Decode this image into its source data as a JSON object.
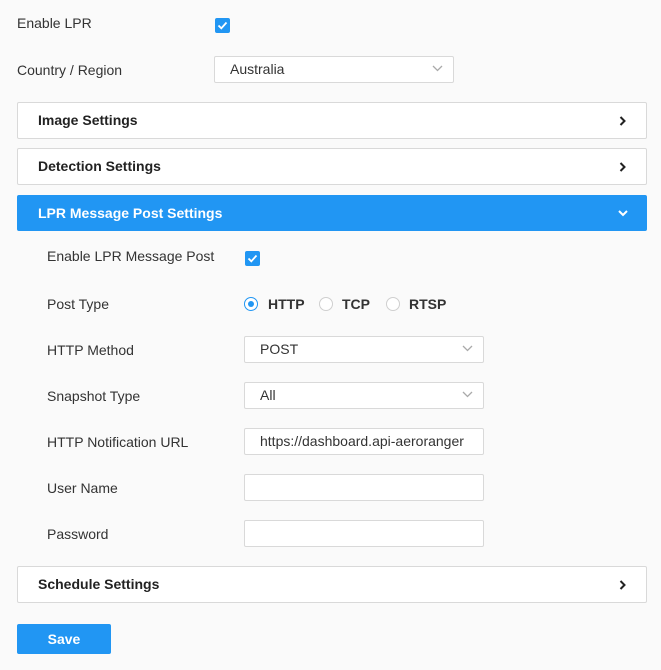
{
  "enable_lpr": {
    "label": "Enable LPR",
    "checked": true
  },
  "country": {
    "label": "Country / Region",
    "value": "Australia"
  },
  "panels": {
    "image": {
      "title": "Image Settings",
      "expanded": false
    },
    "detection": {
      "title": "Detection Settings",
      "expanded": false
    },
    "lpr_post": {
      "title": "LPR Message Post Settings",
      "expanded": true
    },
    "schedule": {
      "title": "Schedule Settings",
      "expanded": false
    }
  },
  "lpr_post": {
    "enable": {
      "label": "Enable LPR Message Post",
      "checked": true
    },
    "post_type": {
      "label": "Post Type",
      "options": [
        "HTTP",
        "TCP",
        "RTSP"
      ],
      "selected": "HTTP"
    },
    "http_method": {
      "label": "HTTP Method",
      "value": "POST"
    },
    "snapshot_type": {
      "label": "Snapshot Type",
      "value": "All"
    },
    "notification_url": {
      "label": "HTTP Notification URL",
      "value": "https://dashboard.api-aeroranger"
    },
    "username": {
      "label": "User Name",
      "value": ""
    },
    "password": {
      "label": "Password",
      "value": ""
    }
  },
  "save_label": "Save",
  "colors": {
    "accent": "#2196f3",
    "background": "#fafafa",
    "border": "#d9d9d9"
  }
}
